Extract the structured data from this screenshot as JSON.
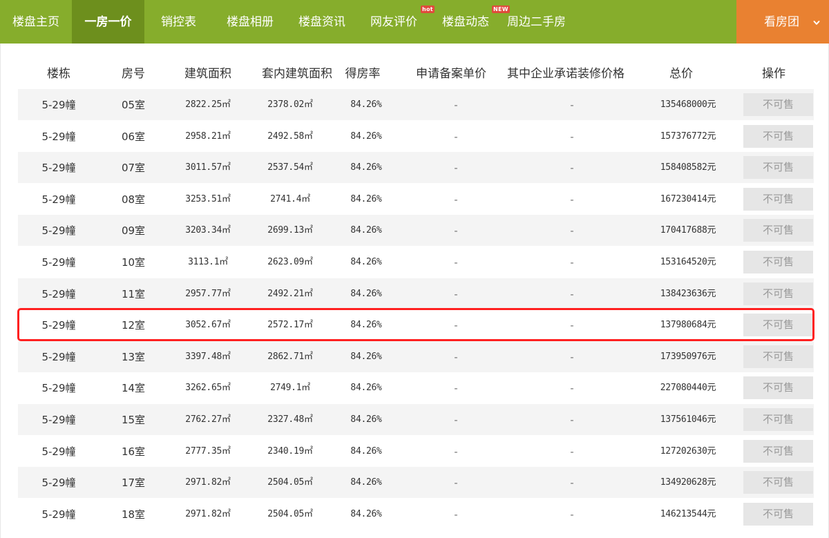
{
  "nav": {
    "items": [
      {
        "label": "楼盘主页",
        "active": false
      },
      {
        "label": "一房一价",
        "active": true
      },
      {
        "label": "销控表",
        "active": false
      },
      {
        "label": "楼盘相册",
        "active": false
      },
      {
        "label": "楼盘资讯",
        "active": false
      },
      {
        "label": "网友评价",
        "active": false,
        "badge": "hot"
      },
      {
        "label": "楼盘动态",
        "active": false,
        "badge": "NEW"
      },
      {
        "label": "周边二手房",
        "active": false
      }
    ],
    "cta_label": "看房团",
    "colors": {
      "bar": "#86ad2c",
      "active": "#6d8f1d",
      "cta": "#e98131",
      "badge": "#e04a3c"
    }
  },
  "table": {
    "headers": [
      "楼栋",
      "房号",
      "建筑面积",
      "套内建筑面积",
      "得房率",
      "申请备案单价",
      "其中企业承诺装修价格",
      "总价",
      "操作"
    ],
    "rows": [
      {
        "building": "5-29幢",
        "room": "05室",
        "area": "2822.25㎡",
        "inner_area": "2378.02㎡",
        "ratio": "84.26%",
        "unit_price": "-",
        "decor_price": "-",
        "total": "135468000元",
        "action": "不可售"
      },
      {
        "building": "5-29幢",
        "room": "06室",
        "area": "2958.21㎡",
        "inner_area": "2492.58㎡",
        "ratio": "84.26%",
        "unit_price": "-",
        "decor_price": "-",
        "total": "157376772元",
        "action": "不可售"
      },
      {
        "building": "5-29幢",
        "room": "07室",
        "area": "3011.57㎡",
        "inner_area": "2537.54㎡",
        "ratio": "84.26%",
        "unit_price": "-",
        "decor_price": "-",
        "total": "158408582元",
        "action": "不可售"
      },
      {
        "building": "5-29幢",
        "room": "08室",
        "area": "3253.51㎡",
        "inner_area": "2741.4㎡",
        "ratio": "84.26%",
        "unit_price": "-",
        "decor_price": "-",
        "total": "167230414元",
        "action": "不可售"
      },
      {
        "building": "5-29幢",
        "room": "09室",
        "area": "3203.34㎡",
        "inner_area": "2699.13㎡",
        "ratio": "84.26%",
        "unit_price": "-",
        "decor_price": "-",
        "total": "170417688元",
        "action": "不可售"
      },
      {
        "building": "5-29幢",
        "room": "10室",
        "area": "3113.1㎡",
        "inner_area": "2623.09㎡",
        "ratio": "84.26%",
        "unit_price": "-",
        "decor_price": "-",
        "total": "153164520元",
        "action": "不可售"
      },
      {
        "building": "5-29幢",
        "room": "11室",
        "area": "2957.77㎡",
        "inner_area": "2492.21㎡",
        "ratio": "84.26%",
        "unit_price": "-",
        "decor_price": "-",
        "total": "138423636元",
        "action": "不可售"
      },
      {
        "building": "5-29幢",
        "room": "12室",
        "area": "3052.67㎡",
        "inner_area": "2572.17㎡",
        "ratio": "84.26%",
        "unit_price": "-",
        "decor_price": "-",
        "total": "137980684元",
        "action": "不可售",
        "highlighted": true
      },
      {
        "building": "5-29幢",
        "room": "13室",
        "area": "3397.48㎡",
        "inner_area": "2862.71㎡",
        "ratio": "84.26%",
        "unit_price": "-",
        "decor_price": "-",
        "total": "173950976元",
        "action": "不可售"
      },
      {
        "building": "5-29幢",
        "room": "14室",
        "area": "3262.65㎡",
        "inner_area": "2749.1㎡",
        "ratio": "84.26%",
        "unit_price": "-",
        "decor_price": "-",
        "total": "227080440元",
        "action": "不可售"
      },
      {
        "building": "5-29幢",
        "room": "15室",
        "area": "2762.27㎡",
        "inner_area": "2327.48㎡",
        "ratio": "84.26%",
        "unit_price": "-",
        "decor_price": "-",
        "total": "137561046元",
        "action": "不可售"
      },
      {
        "building": "5-29幢",
        "room": "16室",
        "area": "2777.35㎡",
        "inner_area": "2340.19㎡",
        "ratio": "84.26%",
        "unit_price": "-",
        "decor_price": "-",
        "total": "127202630元",
        "action": "不可售"
      },
      {
        "building": "5-29幢",
        "room": "17室",
        "area": "2971.82㎡",
        "inner_area": "2504.05㎡",
        "ratio": "84.26%",
        "unit_price": "-",
        "decor_price": "-",
        "total": "134920628元",
        "action": "不可售"
      },
      {
        "building": "5-29幢",
        "room": "18室",
        "area": "2971.82㎡",
        "inner_area": "2504.05㎡",
        "ratio": "84.26%",
        "unit_price": "-",
        "decor_price": "-",
        "total": "146213544元",
        "action": "不可售"
      }
    ],
    "colors": {
      "stripe": "#f4f4f4",
      "button_bg": "#e6e6e6",
      "button_text": "#999999",
      "highlight_border": "#ff2020"
    }
  }
}
